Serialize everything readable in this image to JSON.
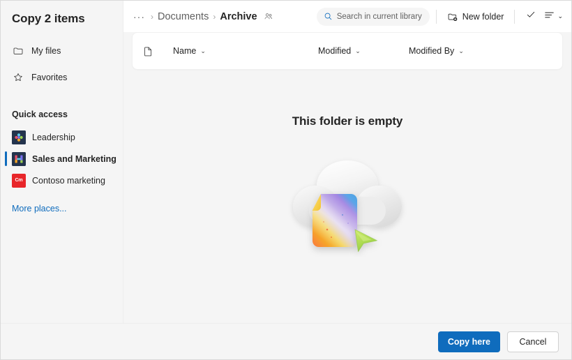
{
  "dialog": {
    "title": "Copy 2 items"
  },
  "sidebar": {
    "nav": [
      {
        "label": "My files",
        "icon": "folder-icon"
      },
      {
        "label": "Favorites",
        "icon": "star-icon"
      }
    ],
    "quick_access_header": "Quick access",
    "quick_access": [
      {
        "label": "Leadership",
        "icon": "site-tile-leadership",
        "tile_text": "",
        "selected": false
      },
      {
        "label": "Sales and Marketing",
        "icon": "site-tile-sales",
        "tile_text": "",
        "selected": true
      },
      {
        "label": "Contoso marketing",
        "icon": "site-tile-contoso",
        "tile_text": "Cm",
        "selected": false
      }
    ],
    "more_places": "More places..."
  },
  "commandbar": {
    "breadcrumb": {
      "overflow": "···",
      "separator": "›",
      "items": [
        {
          "label": "Documents",
          "current": false
        },
        {
          "label": "Archive",
          "current": true
        }
      ],
      "shared_icon": "people-shared-icon"
    },
    "search": {
      "placeholder": "Search in current library",
      "icon": "search-icon"
    },
    "new_folder": {
      "label": "New folder",
      "icon": "new-folder-icon"
    },
    "check_icon": "checkmark-icon",
    "view_options_icon": "list-view-icon",
    "view_options_chevron": "⌄"
  },
  "list": {
    "file_icon": "document-icon",
    "columns": [
      {
        "label": "Name",
        "chevron": "⌄"
      },
      {
        "label": "Modified",
        "chevron": "⌄"
      },
      {
        "label": "Modified By",
        "chevron": "⌄"
      }
    ]
  },
  "empty_state": {
    "title": "This folder is empty",
    "illustration": "cloud-with-colorful-document-and-green-cursor"
  },
  "footer": {
    "primary_label": "Copy here",
    "secondary_label": "Cancel"
  },
  "colors": {
    "accent": "#0f6cbd",
    "link": "#0f6cbd",
    "sidebar_bg": "#f5f5f5",
    "content_bg": "#f5f5f5",
    "card_bg": "#ffffff",
    "tile_navy": "#24344d",
    "tile_red": "#e8262a"
  }
}
